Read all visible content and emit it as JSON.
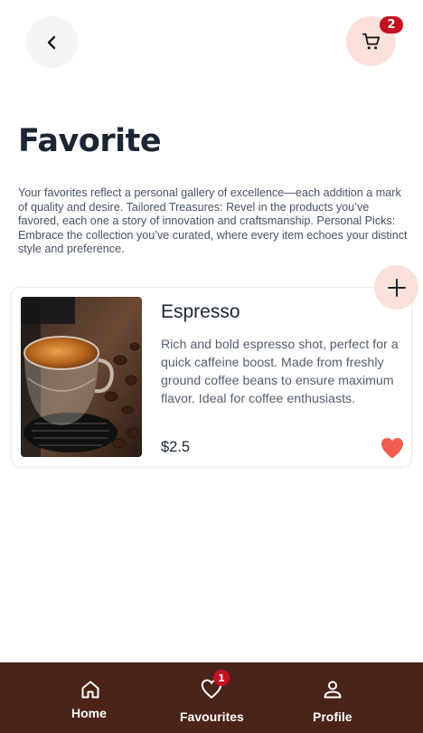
{
  "header": {
    "back_icon": "chevron-left-icon",
    "cart_icon": "cart-icon",
    "cart_count": "2"
  },
  "page": {
    "title": "Favorite",
    "description": "Your favorites reflect a personal gallery of excellence—each addition a mark of quality and desire. Tailored Treasures: Revel in the products you’ve favored, each one a story of innovation and craftsmanship. Personal Picks: Embrace the collection you’ve curated, where every item echoes your distinct style and preference."
  },
  "favorites": [
    {
      "name": "Espresso",
      "description": "Rich and bold espresso shot, perfect for a quick caffeine boost. Made from freshly ground coffee beans to ensure maximum flavor. Ideal for coffee enthusiasts.",
      "price": "$2.5",
      "favorited": true
    }
  ],
  "colors": {
    "accent_bg": "#fbe1da",
    "badge": "#c4101f",
    "heart": "#f25b4e",
    "nav_bg": "#4a2418"
  },
  "bottom_nav": {
    "items": [
      {
        "label": "Home",
        "icon": "home-icon"
      },
      {
        "label": "Favourites",
        "icon": "heart-outline-icon",
        "badge": "1"
      },
      {
        "label": "Profile",
        "icon": "user-icon"
      }
    ]
  }
}
